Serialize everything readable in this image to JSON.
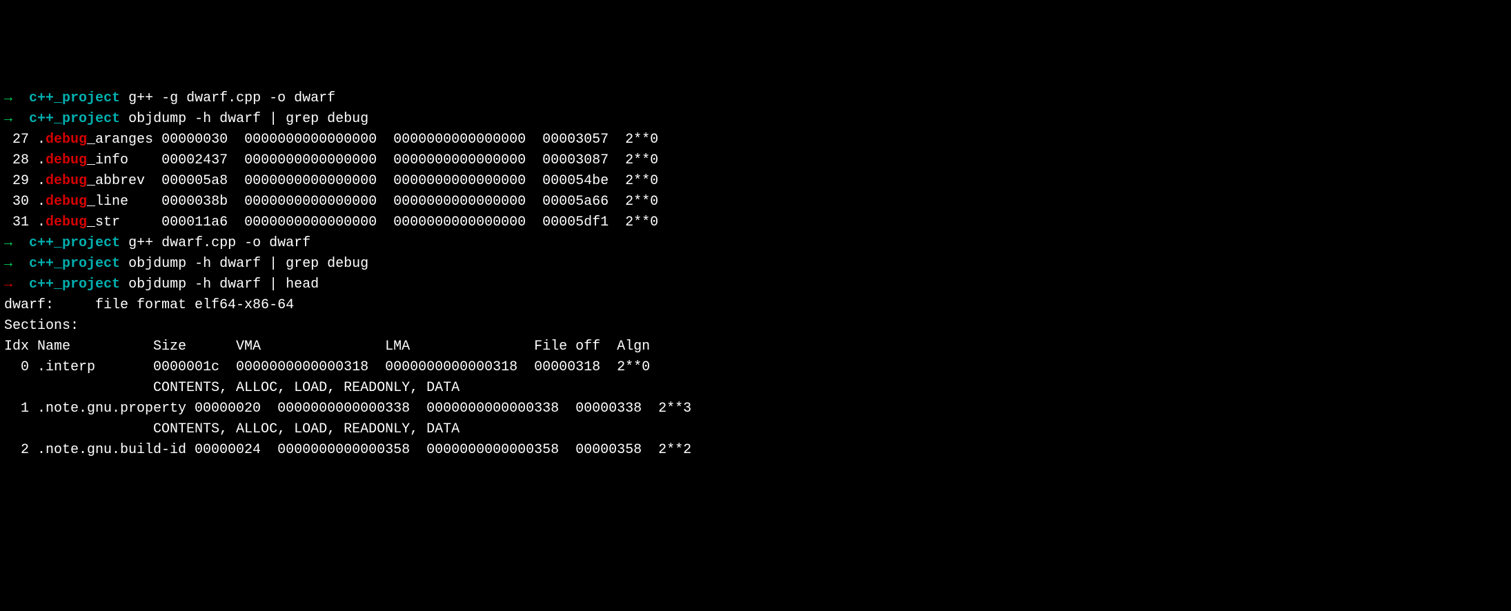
{
  "prompts": [
    {
      "arrow": "→",
      "arrowColor": "green",
      "dir": "c++_project",
      "cmd": "g++ -g dwarf.cpp -o dwarf"
    },
    {
      "arrow": "→",
      "arrowColor": "green",
      "dir": "c++_project",
      "cmd": "objdump -h dwarf | grep debug"
    }
  ],
  "debugLines": [
    {
      "idx": " 27 ",
      "prefix": ".",
      "hl": "debug",
      "suffix": "_aranges 00000030  0000000000000000  0000000000000000  00003057  2**0"
    },
    {
      "idx": " 28 ",
      "prefix": ".",
      "hl": "debug",
      "suffix": "_info    00002437  0000000000000000  0000000000000000  00003087  2**0"
    },
    {
      "idx": " 29 ",
      "prefix": ".",
      "hl": "debug",
      "suffix": "_abbrev  000005a8  0000000000000000  0000000000000000  000054be  2**0"
    },
    {
      "idx": " 30 ",
      "prefix": ".",
      "hl": "debug",
      "suffix": "_line    0000038b  0000000000000000  0000000000000000  00005a66  2**0"
    },
    {
      "idx": " 31 ",
      "prefix": ".",
      "hl": "debug",
      "suffix": "_str     000011a6  0000000000000000  0000000000000000  00005df1  2**0"
    }
  ],
  "prompts2": [
    {
      "arrow": "→",
      "arrowColor": "green",
      "dir": "c++_project",
      "cmd": "g++ dwarf.cpp -o dwarf"
    },
    {
      "arrow": "→",
      "arrowColor": "green",
      "dir": "c++_project",
      "cmd": "objdump -h dwarf | grep debug"
    },
    {
      "arrow": "→",
      "arrowColor": "red",
      "dir": "c++_project",
      "cmd": "objdump -h dwarf | head"
    }
  ],
  "blank1": "",
  "fileFormat": "dwarf:     file format elf64-x86-64",
  "blank2": "",
  "sectionsHeader": "Sections:",
  "tableHeader": "Idx Name          Size      VMA               LMA               File off  Algn",
  "sections": [
    "  0 .interp       0000001c  0000000000000318  0000000000000318  00000318  2**0",
    "                  CONTENTS, ALLOC, LOAD, READONLY, DATA",
    "  1 .note.gnu.property 00000020  0000000000000338  0000000000000338  00000338  2**3",
    "                  CONTENTS, ALLOC, LOAD, READONLY, DATA",
    "  2 .note.gnu.build-id 00000024  0000000000000358  0000000000000358  00000358  2**2"
  ]
}
